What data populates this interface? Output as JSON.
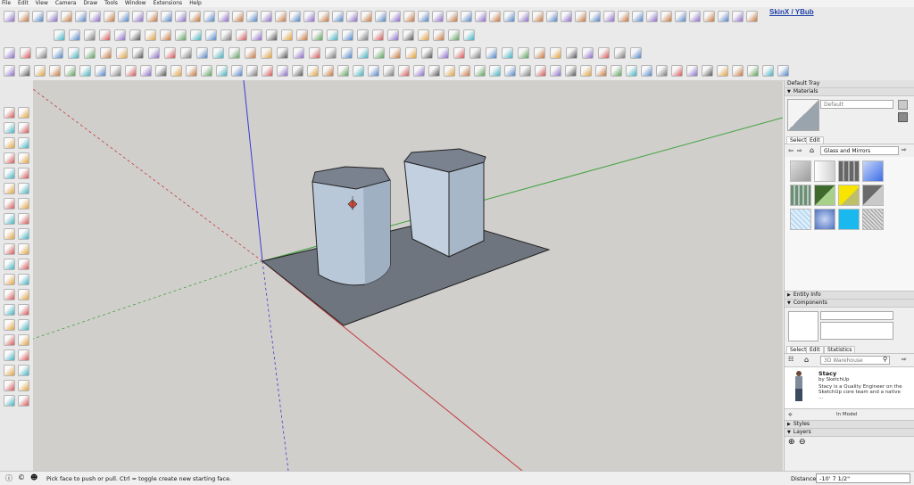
{
  "menu": [
    "File",
    "Edit",
    "View",
    "Camera",
    "Draw",
    "Tools",
    "Window",
    "Extensions",
    "Help"
  ],
  "brand": "SkinX / YBub",
  "status": {
    "hint": "Pick face to push or pull.  Ctrl = toggle create new starting face.",
    "distance_label": "Distance",
    "distance_value": "-10' 7 1/2\""
  },
  "tray": {
    "title": "Default Tray",
    "materials": {
      "header": "Materials",
      "name": "Default",
      "tabs": [
        "Select",
        "Edit"
      ],
      "library": "Glass and Mirrors"
    },
    "entity_info": "Entity Info",
    "components": {
      "header": "Components",
      "tabs": [
        "Select",
        "Edit",
        "Statistics"
      ],
      "search_placeholder": "3D Warehouse",
      "item": {
        "name": "Stacy",
        "author": "by SketchUp",
        "description": "Stacy is a Quality Engineer on the SketchUp core team and a native ..."
      },
      "in_model": "In Model"
    },
    "styles": "Styles",
    "layers": "Layers"
  },
  "colors": {
    "viewport_bg": "#d1cfcc",
    "ground": "#6f757e",
    "solid_light": "#c0cedd",
    "solid_mid": "#a3b3c4",
    "axis_red": "#c23a3a",
    "axis_green": "#3fa33f",
    "axis_blue": "#3a3ad0"
  },
  "icons": [
    "select-icon",
    "eraser-icon",
    "paint-bucket-icon",
    "line-icon",
    "arc-icon",
    "rectangle-icon",
    "push-pull-icon",
    "move-icon",
    "rotate-icon",
    "scale-icon",
    "offset-icon",
    "tape-measure-icon",
    "text-icon",
    "axes-icon",
    "orbit-icon",
    "pan-icon",
    "zoom-icon",
    "zoom-extents-icon"
  ]
}
